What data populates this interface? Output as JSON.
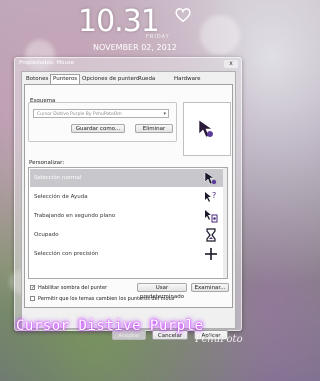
{
  "clock": {
    "time": "10.31",
    "day": "FRIDAY",
    "date": "NOVEMBER 02, 2012"
  },
  "window": {
    "title": "Propiedades: Mouse",
    "close": "x",
    "tabs": [
      {
        "label": "Botones"
      },
      {
        "label": "Punteros"
      },
      {
        "label": "Opciones de puntero"
      },
      {
        "label": "Rueda"
      },
      {
        "label": "Hardware"
      }
    ],
    "active_tab": "Punteros",
    "scheme": {
      "label": "Esquema",
      "value": "Cursor Distive Purple By PchuPotoOm",
      "save_label": "Guardar como...",
      "delete_label": "Eliminar"
    },
    "customize": {
      "label": "Personalizar:",
      "rows": [
        {
          "label": "Selección normal",
          "icon": "arrow-cursor-icon",
          "selected": true
        },
        {
          "label": "Selección de Ayuda",
          "icon": "help-cursor-icon",
          "selected": false
        },
        {
          "label": "Trabajando en segundo plano",
          "icon": "working-cursor-icon",
          "selected": false
        },
        {
          "label": "Ocupado",
          "icon": "busy-hourglass-icon",
          "selected": false
        },
        {
          "label": "Selección con precisión",
          "icon": "crosshair-cursor-icon",
          "selected": false
        }
      ]
    },
    "shadow_check": {
      "label": "Habilitar sombra del punter",
      "checked": true
    },
    "default_label": "Usar predeterminado",
    "browse_label": "Examinar...",
    "themes_check": {
      "label": "Permitir que los temas cambien los punteros del mous",
      "checked": false
    },
    "footer": {
      "ok": "Aceptar",
      "cancel": "Cancelar",
      "apply": "Aplicar"
    }
  },
  "branding": {
    "text": "Cursor Distive Purple",
    "signature": "PchuPoto"
  },
  "colors": {
    "cursor_purple": "#4a2a7a",
    "accent_purple": "#b040ff"
  }
}
